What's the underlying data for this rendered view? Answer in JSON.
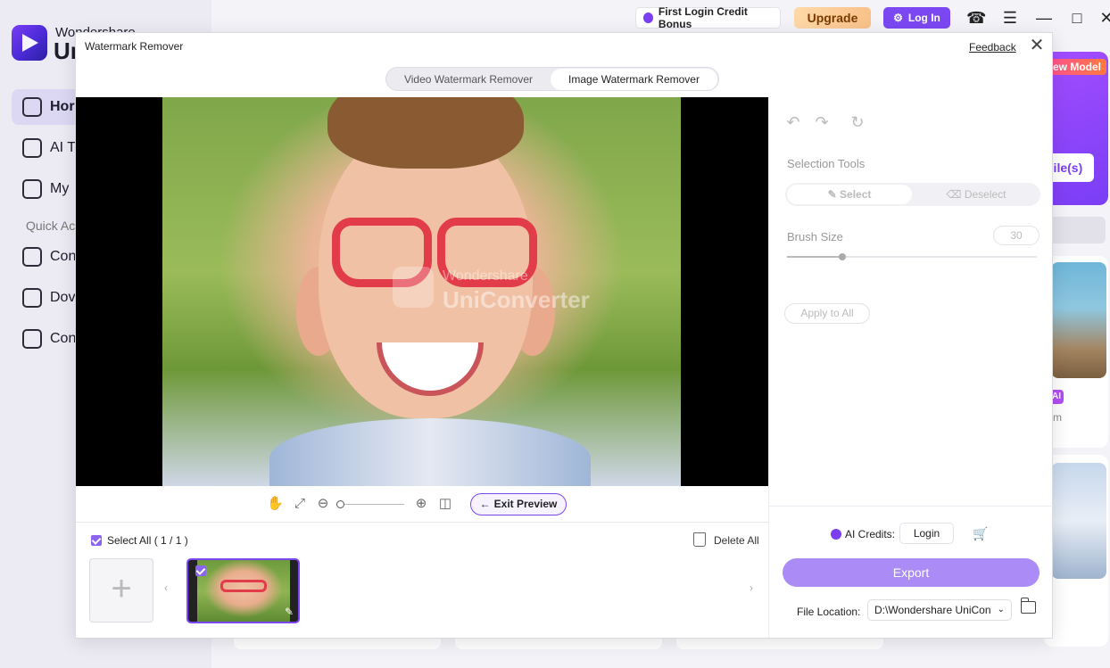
{
  "app": {
    "brand_top": "Wondershare",
    "brand_main": "Uni",
    "nav": [
      {
        "label": "Hor"
      },
      {
        "label": "AI To"
      },
      {
        "label": "My"
      }
    ],
    "section": "Quick Ac",
    "quick": [
      {
        "label": "Con"
      },
      {
        "label": "Dov"
      },
      {
        "label": "Con"
      }
    ],
    "topbar": {
      "bonus": "First Login Credit Bonus",
      "upgrade": "Upgrade",
      "login": "Log In"
    },
    "promo": {
      "new_model": "ew Model",
      "files": "File(s)",
      "ai_badge": "AI",
      "m_text": "m"
    }
  },
  "dialog": {
    "title": "Watermark Remover",
    "feedback": "Feedback",
    "close": "✕",
    "tabs": {
      "video": "Video Watermark Remover",
      "image": "Image Watermark Remover",
      "active": "image"
    },
    "watermark_overlay": {
      "line1": "Wondershare",
      "line2": "UniConverter"
    },
    "toolbar": {
      "exit_preview": "Exit Preview",
      "zoom_level": 0
    },
    "files": {
      "select_all": "Select All ( 1 / 1 )",
      "delete_all": "Delete All",
      "add": "+",
      "prev": "‹",
      "next": "›"
    },
    "panel": {
      "selection_tools": "Selection Tools",
      "select": "Select",
      "deselect": "Deselect",
      "brush_size_label": "Brush Size",
      "brush_size_value": "30",
      "apply_to_all": "Apply to All",
      "ai_credits": "AI Credits:",
      "login": "Login",
      "export": "Export",
      "file_location_label": "File Location:",
      "file_location_value": "D:\\Wondershare UniCon"
    }
  },
  "colors": {
    "accent": "#7b47f2",
    "export_disabled": "#ab8bf5",
    "glasses_red": "#e23b4a"
  }
}
